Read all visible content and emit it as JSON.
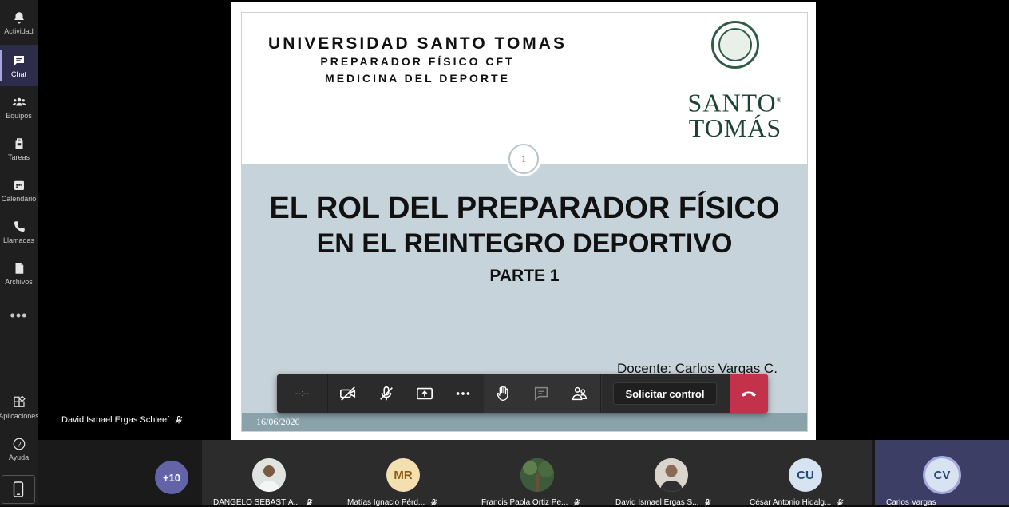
{
  "rail": {
    "items": [
      {
        "label": "Actividad",
        "icon": "bell-icon"
      },
      {
        "label": "Chat",
        "icon": "chat-icon"
      },
      {
        "label": "Equipos",
        "icon": "teams-icon"
      },
      {
        "label": "Tareas",
        "icon": "assignments-icon"
      },
      {
        "label": "Calendario",
        "icon": "calendar-icon"
      },
      {
        "label": "Llamadas",
        "icon": "phone-icon"
      },
      {
        "label": "Archivos",
        "icon": "file-icon"
      }
    ],
    "more": "•••",
    "bottom": [
      {
        "label": "Aplicaciones",
        "icon": "apps-icon"
      },
      {
        "label": "Ayuda",
        "icon": "help-icon"
      }
    ]
  },
  "presenter": {
    "name": "David Ismael Ergas Schleef"
  },
  "slide": {
    "university": "UNIVERSIDAD  SANTO  TOMAS",
    "program": "PREPARADOR FÍSICO CFT",
    "field": "MEDICINA DEL DEPORTE",
    "brand_line1": "SANTO",
    "brand_line2": "TOMÁS",
    "brand_mark": "®",
    "number": "1",
    "title": "EL ROL DEL PREPARADOR FÍSICO",
    "subtitle": "EN EL REINTEGRO DEPORTIVO",
    "part": "PARTE 1",
    "teacher": "Docente: Carlos Vargas C.",
    "date": "16/06/2020"
  },
  "controls": {
    "timer": "--:--",
    "request_control": "Solicitar control"
  },
  "participants": {
    "more_count": "+10",
    "tiles": [
      {
        "name": "DANGELO SEBASTIA...",
        "initials": ""
      },
      {
        "name": "Matías Ignacio Pérd...",
        "initials": "MR"
      },
      {
        "name": "Francis Paola Ortiz Pe...",
        "initials": ""
      },
      {
        "name": "David Ismael Ergas S...",
        "initials": ""
      },
      {
        "name": "César Antonio Hidalg...",
        "initials": "CU"
      },
      {
        "name": "Carlos Vargas",
        "initials": "CV"
      }
    ]
  }
}
